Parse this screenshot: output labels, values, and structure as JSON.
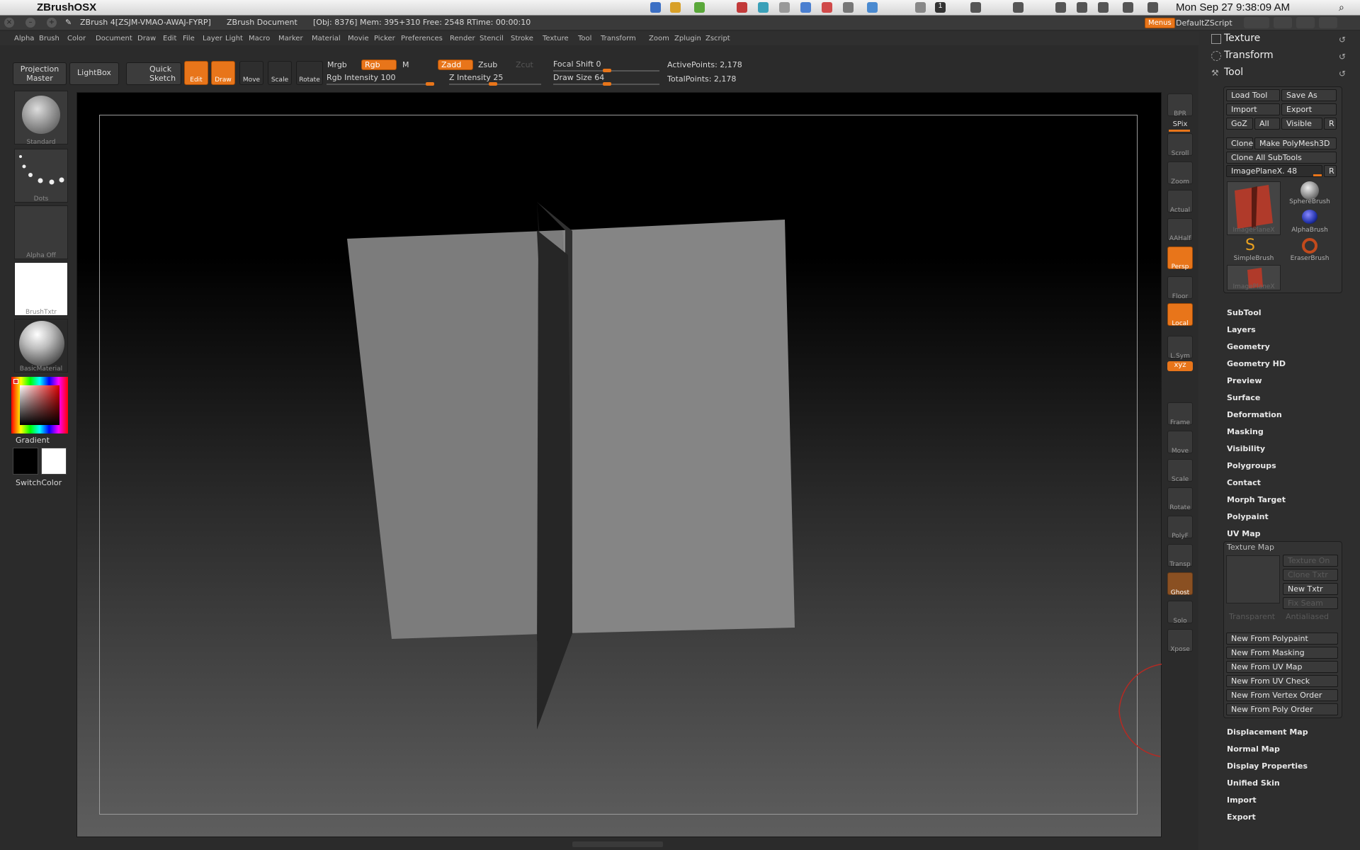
{
  "macmenubar": {
    "app_name": "ZBrushOSX",
    "clock": "Mon Sep 27  9:38:09 AM"
  },
  "titlebar": {
    "title": "ZBrush 4[ZSJM-VMAO-AWAJ-FYRP]",
    "document": "ZBrush Document",
    "stats": "[Obj: 8376] Mem: 395+310 Free: 2548 RTime: 00:00:10"
  },
  "topright": {
    "menus_label": "Menus",
    "script_label": "DefaultZScript"
  },
  "mainmenu": [
    "Alpha",
    "Brush",
    "Color",
    "Document",
    "Draw",
    "Edit",
    "File",
    "Layer",
    "Light",
    "Macro",
    "Marker",
    "Material",
    "Movie",
    "Picker",
    "Preferences",
    "Render",
    "Stencil",
    "Stroke",
    "Texture",
    "Tool",
    "Transform",
    "Zoom",
    "Zplugin",
    "Zscript"
  ],
  "toolbar": {
    "projection_master": [
      "Projection",
      "Master"
    ],
    "lightbox": "LightBox",
    "quick_sketch": [
      "Quick",
      "Sketch"
    ],
    "edit": "Edit",
    "draw": "Draw",
    "move": "Move",
    "scale": "Scale",
    "rotate": "Rotate",
    "mrgb": "Mrgb",
    "rgb": "Rgb",
    "m": "M",
    "zadd": "Zadd",
    "zsub": "Zsub",
    "zcut": "Zcut",
    "rgb_intensity": "Rgb  Intensity 100",
    "z_intensity": "Z Intensity 25",
    "focal_shift": "Focal Shift 0",
    "draw_size": "Draw Size 64",
    "active_points": "ActivePoints: 2,178",
    "total_points": "TotalPoints: 2,178"
  },
  "leftshelf": {
    "brush": "Standard",
    "stroke": "Dots",
    "alpha": "Alpha  Off",
    "texture": "BrushTxtr",
    "material": "BasicMaterial",
    "gradient": "Gradient",
    "switchcolor": "SwitchColor"
  },
  "rightshelf": [
    "BPR",
    "SPix",
    "Scroll",
    "Zoom",
    "Actual",
    "AAHalf",
    "Persp",
    "Floor",
    "Local",
    "L.Sym",
    "Frame",
    "Move",
    "Scale",
    "Rotate",
    "PolyF",
    "Transp",
    "Ghost",
    "Solo",
    "Xpose"
  ],
  "xyz_label": "xyz",
  "palette": {
    "sections": [
      "Texture",
      "Transform",
      "Tool"
    ],
    "tool_buttons": {
      "load": "Load Tool",
      "save": "Save As",
      "import": "Import",
      "export": "Export",
      "goz": "GoZ",
      "all": "All",
      "visible": "Visible",
      "r": "R",
      "clone": "Clone",
      "make_polymesh": "Make PolyMesh3D",
      "clone_all": "Clone  All SubTools",
      "imageplane": "ImagePlaneX. 48"
    },
    "tools": [
      "ImagePlaneX",
      "SphereBrush",
      "AlphaBrush",
      "SimpleBrush",
      "EraserBrush",
      "ImagePlaneX"
    ],
    "submenus": [
      "SubTool",
      "Layers",
      "Geometry",
      "Geometry HD",
      "Preview",
      "Surface",
      "Deformation",
      "Masking",
      "Visibility",
      "Polygroups",
      "Contact",
      "Morph Target",
      "Polypaint",
      "UV Map"
    ],
    "texture_map": {
      "title": "Texture Map",
      "texture_on": "Texture On",
      "clone_txtr": "Clone Txtr",
      "new_txtr": "New Txtr",
      "fix_seam": "Fix Seam",
      "transparent": "Transparent",
      "antialiased": "Antialiased",
      "new_from": [
        "New From Polypaint",
        "New From Masking",
        "New From UV Map",
        "New From UV Check",
        "New From Vertex Order",
        "New From Poly Order"
      ]
    },
    "submenus2": [
      "Displacement Map",
      "Normal Map",
      "Display Properties",
      "Unified Skin",
      "Import",
      "Export"
    ]
  },
  "colors": {
    "accent": "#e8751a",
    "panel": "#2e2e2e",
    "background": "#2b2b2b"
  }
}
